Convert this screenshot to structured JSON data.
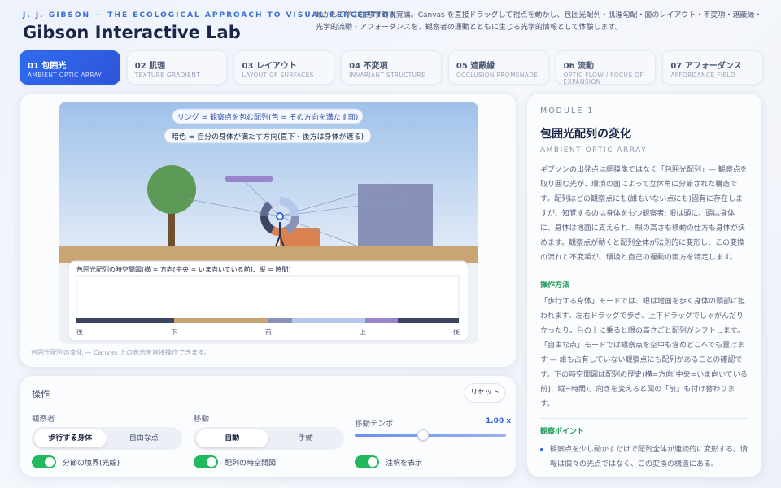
{
  "header": {
    "kicker": "J. J. GIBSON — THE ECOLOGICAL APPROACH TO VISUAL PERCEPTION",
    "title": "Gibson Interactive Lab",
    "description": "動かして学ぶ生態学的視覚論。Canvas を直接ドラッグして視点を動かし、包囲光配列・肌理勾配・面のレイアウト・不変項・遮蔽縁・光学的流動・アフォーダンスを、観察者の運動とともに生じる光学的情報として体験します。"
  },
  "tabs": [
    {
      "label": "01 包囲光",
      "sub": "AMBIENT OPTIC ARRAY",
      "active": true
    },
    {
      "label": "02 肌理",
      "sub": "TEXTURE GRADIENT",
      "active": false
    },
    {
      "label": "03 レイアウト",
      "sub": "LAYOUT OF SURFACES",
      "active": false
    },
    {
      "label": "04 不変項",
      "sub": "INVARIANT STRUCTURE",
      "active": false
    },
    {
      "label": "05 遮蔽縁",
      "sub": "OCCLUSION PROMENADE",
      "active": false
    },
    {
      "label": "06 流動",
      "sub": "OPTIC FLOW / FOCUS OF EXPANSION",
      "active": false
    },
    {
      "label": "07 アフォーダンス",
      "sub": "AFFORDANCE FIELD",
      "active": false
    }
  ],
  "viz": {
    "callout_ring": "リング = 観察点を包む配列(色 = その方向を満たす面)",
    "callout_dark": "暗色 = 自分の身体が満たす方向(直下・後方は身体が遮る)",
    "timeline_title": "包囲光配列の時空間図(横 = 方向[中央 = いま向いている前]、縦 = 時間)",
    "timeline_ticks": [
      "後",
      "下",
      "前",
      "上",
      "後"
    ],
    "caption": "包囲光配列の変化 — Canvas 上の表示を直接操作できます。",
    "colors": {
      "sky": "#a9c8ec",
      "ground": "#c9a574",
      "tree_crown": "#5d9a58",
      "tree_trunk": "#6e4f2e",
      "block": "#8892b8",
      "box": "#d9824f",
      "shelf": "#9a84cc",
      "body_dark": "#3c4560"
    }
  },
  "controls": {
    "title": "操作",
    "reset_label": "リセット",
    "observer_label": "観察者",
    "observer_options": [
      "歩行する身体",
      "自由な点"
    ],
    "move_label": "移動",
    "move_options": [
      "自動",
      "手動"
    ],
    "tempo_label": "移動テンポ",
    "tempo_value": "1.00 x",
    "tempo_fraction": 0.45,
    "toggles": [
      "分節の境界(光線)",
      "配列の時空間図",
      "注釈を表示"
    ]
  },
  "info": {
    "kicker": "MODULE 1",
    "title": "包囲光配列の変化",
    "subtitle": "AMBIENT OPTIC ARRAY",
    "body": "ギブソンの出発点は網膜像ではなく「包囲光配列」— 観察点を取り囲む光が、環境の面によって立体角に分節された構造です。配列はどの観察点にも(誰もいない点にも)固有に存在しますが、知覚するのは身体をもつ観察者: 眼は頭に、頭は身体に、身体は地面に支えられ、眼の高さも移動の仕方も身体が決めます。観察点が動くと配列全体が法則的に変形し、この変換の流れと不変項が、環境と自己の運動の両方を特定します。",
    "howto_title": "操作方法",
    "howto_body": "「歩行する身体」モードでは、眼は地面を歩く身体の頭部に担われます。左右ドラッグで歩き、上下ドラッグでしゃがんだり立ったり。台の上に乗ると眼の高さごと配列がシフトします。「自由な点」モードでは観察点を空中も含めどこへでも置けます — 誰も占有していない観察点にも配列があることの確認です。下の時空間図は配列の歴史(横=方向[中央=いま向いている前]、縦=時間)。向きを変えると図の「前」も付け替わります。",
    "points_title": "観察ポイント",
    "points": [
      "観察点を少し動かすだけで配列全体が連続的に変形する。情報は個々の光点ではなく、この変換の構造にある。"
    ]
  }
}
